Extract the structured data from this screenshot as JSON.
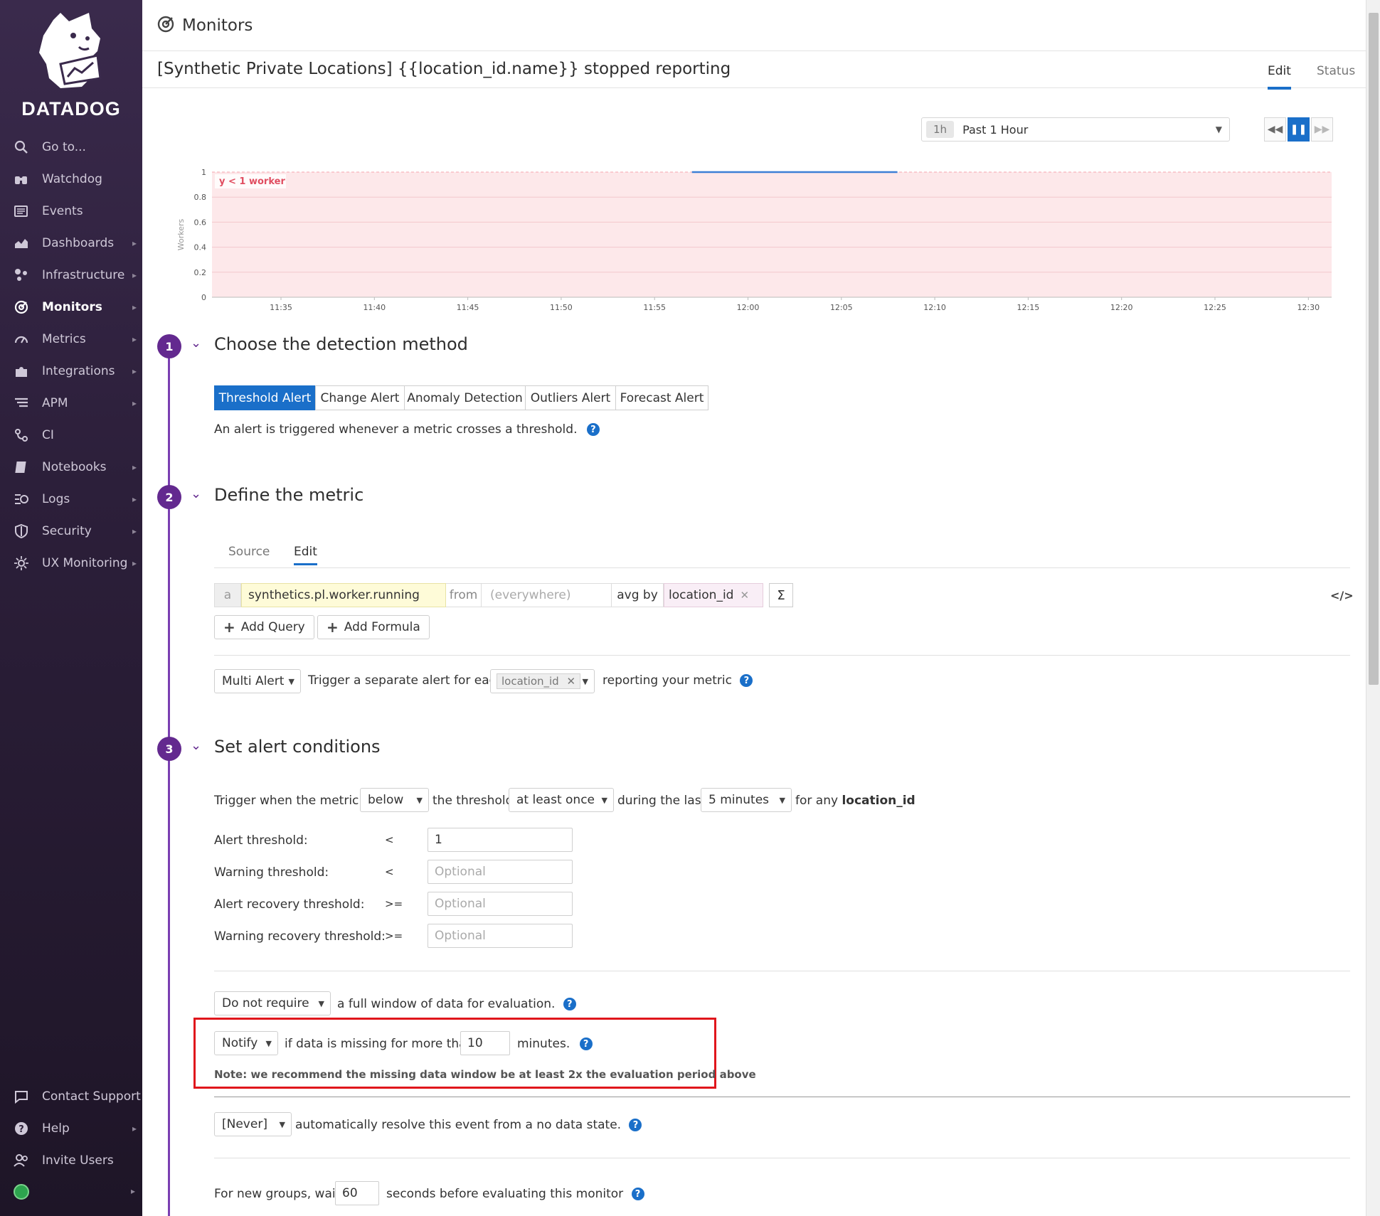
{
  "app": {
    "brand": "DATADOG",
    "section": "Monitors"
  },
  "sidebar": {
    "items": [
      {
        "label": "Go to...",
        "icon": "search-icon",
        "chevron": false
      },
      {
        "label": "Watchdog",
        "icon": "binoculars-icon",
        "chevron": false
      },
      {
        "label": "Events",
        "icon": "events-icon",
        "chevron": false
      },
      {
        "label": "Dashboards",
        "icon": "dashboard-icon",
        "chevron": true
      },
      {
        "label": "Infrastructure",
        "icon": "infrastructure-icon",
        "chevron": true
      },
      {
        "label": "Monitors",
        "icon": "monitors-icon",
        "chevron": true,
        "active": true
      },
      {
        "label": "Metrics",
        "icon": "metrics-icon",
        "chevron": true
      },
      {
        "label": "Integrations",
        "icon": "puzzle-icon",
        "chevron": true
      },
      {
        "label": "APM",
        "icon": "apm-icon",
        "chevron": true
      },
      {
        "label": "CI",
        "icon": "ci-icon",
        "chevron": false
      },
      {
        "label": "Notebooks",
        "icon": "notebook-icon",
        "chevron": true
      },
      {
        "label": "Logs",
        "icon": "logs-icon",
        "chevron": true
      },
      {
        "label": "Security",
        "icon": "shield-icon",
        "chevron": true
      },
      {
        "label": "UX Monitoring",
        "icon": "ux-monitoring-icon",
        "chevron": true
      }
    ],
    "bottom": [
      {
        "label": "Contact Support",
        "icon": "chat-icon",
        "chevron": false
      },
      {
        "label": "Help",
        "icon": "help-icon",
        "chevron": true
      },
      {
        "label": "Invite Users",
        "icon": "users-icon",
        "chevron": false
      }
    ]
  },
  "monitor": {
    "title": "[Synthetic Private Locations] {{location_id.name}} stopped reporting",
    "tabs": [
      {
        "label": "Edit",
        "selected": true
      },
      {
        "label": "Status",
        "selected": false
      }
    ]
  },
  "timeframe": {
    "badge": "1h",
    "label": "Past 1 Hour"
  },
  "chart_data": {
    "type": "line",
    "ylabel": "Workers",
    "yticks": [
      "1",
      "0.8",
      "0.6",
      "0.4",
      "0.2",
      "0"
    ],
    "xticks": [
      "11:35",
      "11:40",
      "11:45",
      "11:50",
      "11:55",
      "12:00",
      "12:05",
      "12:10",
      "12:15",
      "12:20",
      "12:25",
      "12:30"
    ],
    "ylim": [
      0,
      1
    ],
    "threshold_label": "y < 1 worker",
    "threshold_value": 1,
    "series": [
      {
        "x": [
          "11:57",
          "12:08"
        ],
        "values": [
          1,
          1
        ]
      }
    ],
    "colors": {
      "series": "#3d7fd6",
      "threshold_fill": "#fde8ea",
      "threshold_label": "#e04e61"
    }
  },
  "step1": {
    "number": "1",
    "title": "Choose the detection method",
    "methods": [
      "Threshold Alert",
      "Change Alert",
      "Anomaly Detection",
      "Outliers Alert",
      "Forecast Alert"
    ],
    "selected": "Threshold Alert",
    "description": "An alert is triggered whenever a metric crosses a threshold."
  },
  "step2": {
    "number": "2",
    "title": "Define the metric",
    "subtabs": [
      "Source",
      "Edit"
    ],
    "query": {
      "letter": "a",
      "metric": "synthetics.pl.worker.running",
      "from": "from",
      "scope_placeholder": "(everywhere)",
      "avg_by": "avg by",
      "group": "location_id"
    },
    "add_query": "Add Query",
    "add_formula": "Add Formula",
    "multi_alert": "Multi Alert",
    "trigger_text": "Trigger a separate alert for each",
    "group_tag": "location_id",
    "reporting_text": "reporting your metric"
  },
  "step3": {
    "number": "3",
    "title": "Set alert conditions",
    "trigger_prefix": "Trigger when the metric is",
    "comparator": "below",
    "threshold_text": "the threshold",
    "occurrence": "at least once",
    "during_text": "during the last",
    "window": "5 minutes",
    "for_any": "for any",
    "group": "location_id",
    "thresholds": [
      {
        "label": "Alert threshold:",
        "op": "<",
        "value": "1",
        "placeholder": ""
      },
      {
        "label": "Warning threshold:",
        "op": "<",
        "value": "",
        "placeholder": "Optional"
      },
      {
        "label": "Alert recovery threshold:",
        "op": ">=",
        "value": "",
        "placeholder": "Optional"
      },
      {
        "label": "Warning recovery threshold:",
        "op": ">=",
        "value": "",
        "placeholder": "Optional"
      }
    ],
    "full_window": "Do not require",
    "full_window_text": "a full window of data for evaluation.",
    "notify": "Notify",
    "missing_text": "if data is missing for more than",
    "missing_minutes": "10",
    "minutes_text": "minutes.",
    "note": "Note: we recommend the missing data window be at least 2x the evaluation period above",
    "resolve": "[Never]",
    "resolve_text": "automatically resolve this event from a no data state.",
    "new_groups_prefix": "For new groups, wait",
    "new_groups_seconds": "60",
    "new_groups_suffix": "seconds before evaluating this monitor"
  }
}
